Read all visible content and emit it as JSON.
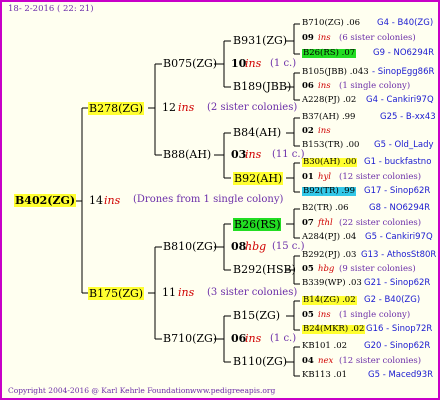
{
  "header": {
    "date": "18-  2-2016 ( 22: 21)"
  },
  "footer": {
    "copyright": "Copyright 2004-2016 @ Karl Kehrle Foundation.",
    "site": "www.pedigreeapis.org"
  },
  "root": {
    "name": "B402(ZG)",
    "count": "14",
    "ins": "ins",
    "note": "(Drones from 1 single colony)"
  },
  "gen1": [
    {
      "name": "B278(ZG)",
      "count": "12",
      "ins": "ins",
      "note": "(2 sister colonies)"
    },
    {
      "name": "B175(ZG)",
      "count": "11",
      "ins": "ins",
      "note": "(3 sister colonies)"
    }
  ],
  "gen2": [
    {
      "name": "B075(ZG)",
      "count": "10",
      "ins": "ins",
      "note": "(1 c.)"
    },
    {
      "name": "B88(AH)",
      "count": "03",
      "ins": "ins",
      "note": "(11 c.)"
    },
    {
      "name": "B810(ZG)",
      "count": "08",
      "ins": "hbg",
      "note": "(15 c.)"
    },
    {
      "name": "B710(ZG)",
      "count": "06",
      "ins": "ins",
      "note": "(1 c.)"
    }
  ],
  "gen3": [
    {
      "name": "B931(ZG)"
    },
    {
      "name": "B189(JBB)"
    },
    {
      "name": "B84(AH)"
    },
    {
      "name": "B92(AH)"
    },
    {
      "name": "B26(RS)"
    },
    {
      "name": "B292(HSB)"
    },
    {
      "name": "B15(ZG)"
    },
    {
      "name": "B110(ZG)"
    }
  ],
  "gen4": [
    {
      "id": "B710(ZG) .06",
      "tail": "G4 - B40(ZG)"
    },
    {
      "cnt": "09",
      "ins": "ins",
      "note": "(6 sister colonies)"
    },
    {
      "id": "B26(RS) .07",
      "tail": "G9 - NO6294R"
    },
    {
      "id": "B105(JBB) .043",
      "tail": "- SinopEgg86R"
    },
    {
      "cnt": "06",
      "ins": "ins",
      "note": "(1 single colony)"
    },
    {
      "id": "A228(PJ) .02",
      "tail": "G4 - Cankiri97Q"
    },
    {
      "id": "B37(AH) .99",
      "tail": "G25 - B-xx43"
    },
    {
      "cnt": "02",
      "ins": "ins",
      "note": ""
    },
    {
      "id": "B153(TR) .00",
      "tail": "G5 - Old_Lady"
    },
    {
      "id": "B30(AH) .00",
      "tail": "G1 - buckfastno"
    },
    {
      "cnt": "01",
      "ins": "hyl",
      "note": "(12 sister colonies)"
    },
    {
      "id": "B92(TR) .99",
      "tail": "G17 - Sinop62R"
    },
    {
      "id": "B2(TR) .06",
      "tail": "G8 - NO6294R"
    },
    {
      "cnt": "07",
      "ins": "fthl",
      "note": "(22 sister colonies)"
    },
    {
      "id": "A284(PJ) .04",
      "tail": "G5 - Cankiri97Q"
    },
    {
      "id": "B292(PJ) .03",
      "tail": "G13 - AthosSt80R"
    },
    {
      "cnt": "05",
      "ins": "hbg",
      "note": "(9 sister colonies)"
    },
    {
      "id": "B339(WP) .03",
      "tail": "G21 - Sinop62R"
    },
    {
      "id": "B14(ZG) .02",
      "tail": "G2 - B40(ZG)"
    },
    {
      "cnt": "05",
      "ins": "ins",
      "note": "(1 single colony)"
    },
    {
      "id": "B24(MKR) .02",
      "tail": "G16 - Sinop72R"
    },
    {
      "id": "KB101 .02",
      "tail": "G20 - Sinop62R"
    },
    {
      "cnt": "04",
      "ins": "nex",
      "note": "(12 sister colonies)"
    },
    {
      "id": "KB113 .01",
      "tail": "G5 - Maced93R"
    }
  ]
}
